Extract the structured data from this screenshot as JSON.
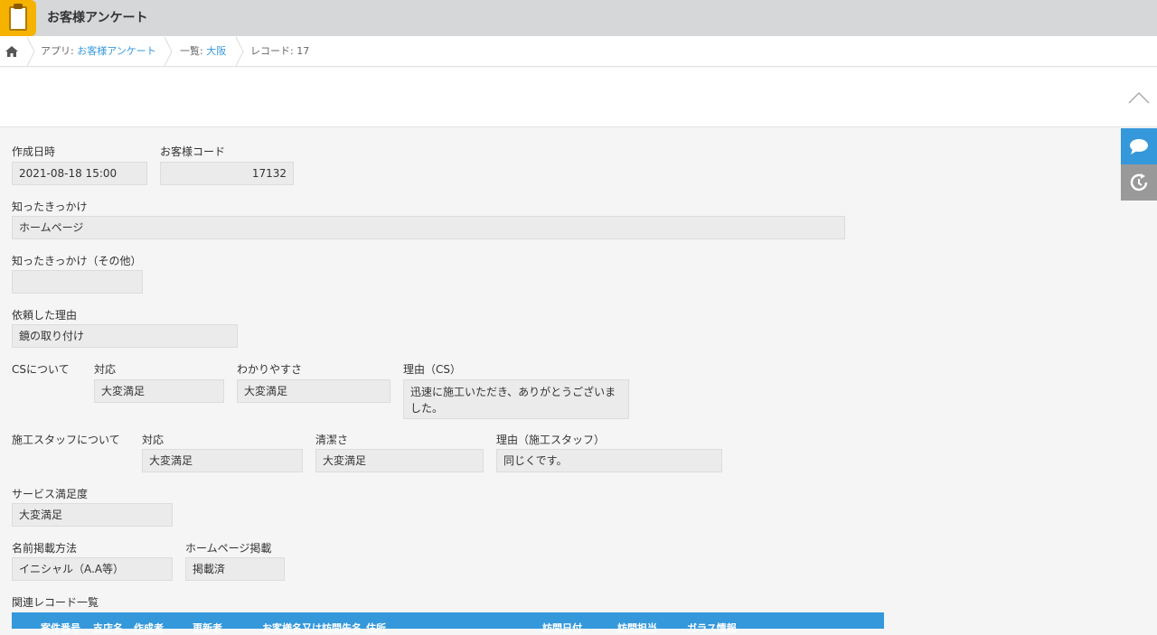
{
  "app": {
    "title": "お客様アンケート"
  },
  "breadcrumb": {
    "app_prefix": "アプリ: ",
    "app_link": "お客様アンケート",
    "view_prefix": "一覧: ",
    "view_link": "大阪",
    "record": "レコード: 17"
  },
  "fields": {
    "created_at": {
      "label": "作成日時",
      "value": "2021-08-18 15:00"
    },
    "customer_code": {
      "label": "お客様コード",
      "value": "17132"
    },
    "source": {
      "label": "知ったきっかけ",
      "value": "ホームページ"
    },
    "source_other": {
      "label": "知ったきっかけ（その他）",
      "value": ""
    },
    "reason": {
      "label": "依頼した理由",
      "value": "鏡の取り付け"
    },
    "cs": {
      "group_label": "CSについて",
      "response": {
        "label": "対応",
        "value": "大変満足"
      },
      "clarity": {
        "label": "わかりやすさ",
        "value": "大変満足"
      },
      "comment": {
        "label": "理由（CS）",
        "value": "迅速に施工いただき、ありがとうございました。"
      }
    },
    "staff": {
      "group_label": "施工スタッフについて",
      "response": {
        "label": "対応",
        "value": "大変満足"
      },
      "cleanliness": {
        "label": "清潔さ",
        "value": "大変満足"
      },
      "comment": {
        "label": "理由（施工スタッフ）",
        "value": "同じくです。"
      }
    },
    "satisfaction": {
      "label": "サービス満足度",
      "value": "大変満足"
    },
    "name_method": {
      "label": "名前掲載方法",
      "value": "イニシャル（A.A等）"
    },
    "homepage": {
      "label": "ホームページ掲載",
      "value": "掲載済"
    }
  },
  "related": {
    "label": "関連レコード一覧",
    "columns": [
      "案件番号",
      "支店名",
      "作成者",
      "更新者",
      "お客様名又は訪問先名",
      "住所",
      "訪問日付",
      "訪問担当",
      "ガラス情報"
    ]
  },
  "colors": {
    "accent": "#3498db",
    "app_icon": "#f5b300"
  }
}
